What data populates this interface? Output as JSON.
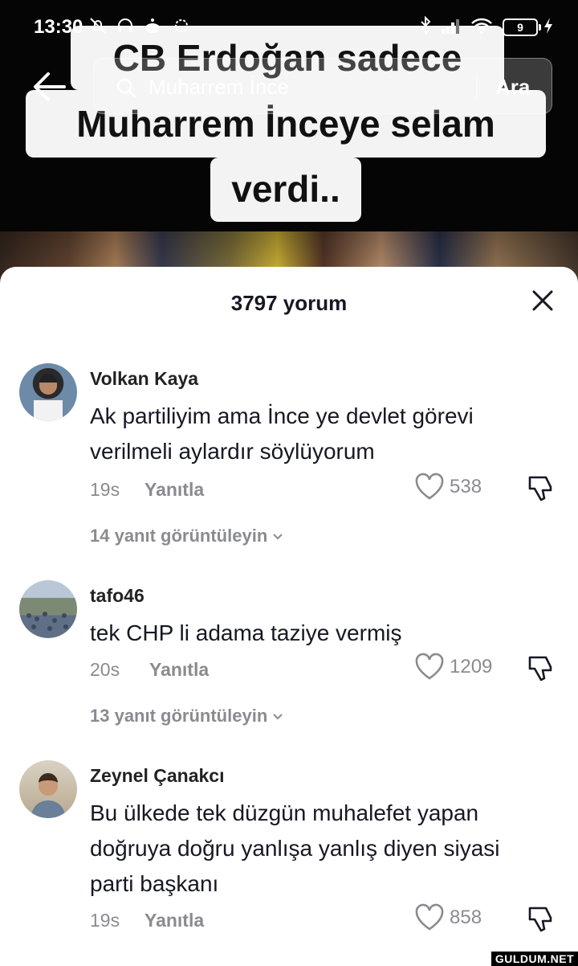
{
  "status_bar": {
    "time": "13:30",
    "battery_level": "9"
  },
  "video": {
    "caption_lines": [
      "CB Erdoğan sadece",
      "Muharrem İnceye selam",
      "verdi.."
    ]
  },
  "search": {
    "query": "Muharrem İnce",
    "submit_label": "Ara"
  },
  "comments_panel": {
    "title": "3797 yorum",
    "comments": [
      {
        "username": "Volkan Kaya",
        "text_lines": [
          "Ak partiliyim ama İnce ye devlet görevi",
          "verilmeli aylardır söylüyorum"
        ],
        "age": "19s",
        "reply_label": "Yanıtla",
        "likes": "538",
        "view_replies": "14 yanıt görüntüleyin"
      },
      {
        "username": "tafo46",
        "text_lines": [
          "tek CHP li adama taziye vermiş"
        ],
        "age": "20s",
        "reply_label": "Yanıtla",
        "likes": "1209",
        "view_replies": "13 yanıt görüntüleyin"
      },
      {
        "username": "Zeynel Çanakcı",
        "text_lines": [
          "Bu ülkede tek düzgün muhalefet yapan",
          "doğruya doğru yanlışa yanlış diyen siyasi",
          "parti başkanı"
        ],
        "age": "19s",
        "reply_label": "Yanıtla",
        "likes": "858"
      }
    ]
  },
  "watermark": "GULDUM.NET",
  "icons": [
    "back-arrow-icon",
    "search-icon",
    "close-icon",
    "heart-icon",
    "dislike-icon",
    "chevron-down-icon"
  ],
  "colors": {
    "sheet_bg": "#ffffff",
    "secondary_text": "#8a8b91",
    "primary_text": "#161823"
  }
}
